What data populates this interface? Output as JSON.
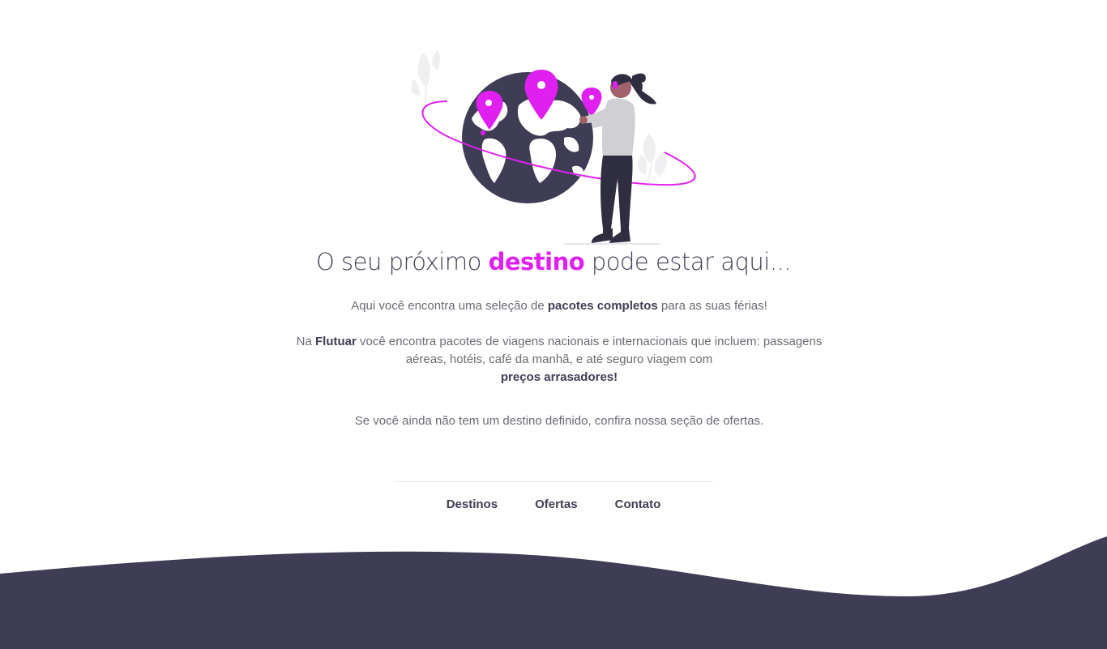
{
  "headline": {
    "prefix": "O seu próximo",
    "highlight": "destino",
    "suffix": "pode estar aqui..."
  },
  "intro": {
    "before": "Aqui você encontra uma seleção de",
    "bold": "pacotes completos",
    "after": "para as suas férias!"
  },
  "details": {
    "prefix": "Na",
    "brand": "Flutuar",
    "body": "você encontra pacotes de viagens nacionais e internacionais que incluem: passagens aéreas, hotéis, café da manhã, e até seguro viagem com",
    "bold": "preços arrasadores!"
  },
  "offers_note": "Se você ainda não tem um destino definido, confira nossa seção de ofertas.",
  "footer": {
    "links": [
      {
        "label": "Destinos"
      },
      {
        "label": "Ofertas"
      },
      {
        "label": "Contato"
      }
    ]
  },
  "colors": {
    "accent": "#e020f0",
    "dark": "#3f3d56",
    "text": "#6b6b74",
    "background": "#ffffff"
  },
  "illustration": {
    "icon": "travel-globe-woman-illustration"
  }
}
